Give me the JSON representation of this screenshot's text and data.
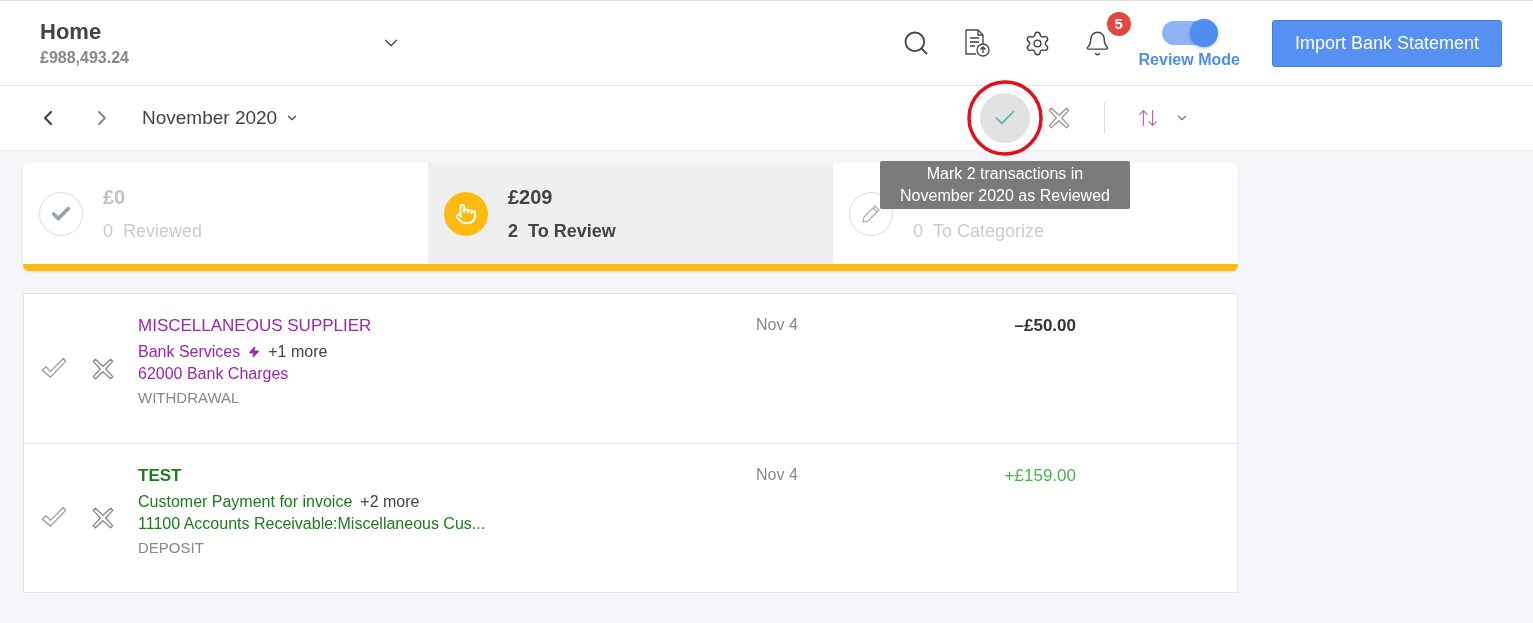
{
  "header": {
    "title": "Home",
    "balance": "£988,493.24",
    "notifications": "5",
    "review_mode": {
      "label": "Review Mode",
      "on": true
    },
    "import_button": "Import Bank Statement"
  },
  "toolbar": {
    "period": "November 2020",
    "tooltip": "Mark 2 transactions in November 2020 as Reviewed"
  },
  "summary_tabs": [
    {
      "kind": "reviewed",
      "amount": "£0",
      "count": "0",
      "label": "Reviewed",
      "selected": false
    },
    {
      "kind": "to_review",
      "amount": "£209",
      "count": "2",
      "label": "To Review",
      "selected": true
    },
    {
      "kind": "to_categorize",
      "count": "0",
      "label": "To Categorize",
      "selected": false
    }
  ],
  "transactions": [
    {
      "kind": "withdrawal",
      "color": "#9c27b0",
      "payee": "MISCELLANEOUS SUPPLIER",
      "category": "Bank Services",
      "auto_matched": true,
      "more": "+1 more",
      "account": "62000 Bank Charges",
      "type": "WITHDRAWAL",
      "date": "Nov 4",
      "amount": "–£50.00"
    },
    {
      "kind": "deposit",
      "color": "#1e7b1e",
      "payee": "TEST",
      "category": "Customer Payment for invoice",
      "auto_matched": false,
      "more": "+2 more",
      "account": "11100 Accounts Receivable:Miscellaneous Cus...",
      "type": "DEPOSIT",
      "date": "Nov 4",
      "amount": "+£159.00"
    }
  ]
}
